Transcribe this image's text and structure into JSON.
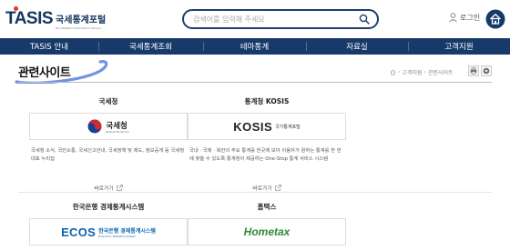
{
  "header": {
    "logo_main": "TASIS",
    "logo_kr": "국세통계포털",
    "logo_en": "Tax Statistics Information Service",
    "search_placeholder": "검색어를 입력해 주세요",
    "login_label": "로그인"
  },
  "nav": {
    "items": [
      "TASIS 안내",
      "국세통계조회",
      "테마통계",
      "자료실",
      "고객지원"
    ]
  },
  "page": {
    "title": "관련사이트",
    "breadcrumb": [
      "고객지원",
      "관련사이트"
    ]
  },
  "cards": [
    {
      "title": "국세청",
      "logo_text": "국세청",
      "logo_sub": "National Tax Service",
      "description": "국세청 소식, 국민소통, 국세신고안내, 국세정책 및 제도, 정보공개 등 국세청 대표 누리집",
      "link_label": "바로가기"
    },
    {
      "title": "통계청 KOSIS",
      "logo_text": "KOSIS",
      "logo_sub": "국가통계포털",
      "description": "국내 · 국제 · 북한의 주요 통계를 한곳에 모아 이용자가 원하는 통계를 한 번에 찾을 수 있도록 통계청이 제공하는 One-Stop 통계 서비스 시스템",
      "link_label": "바로가기"
    },
    {
      "title": "한국은행 경제통계시스템",
      "logo_text": "ECOS",
      "logo_sub": "한국은행 경제통계시스템",
      "logo_sub2": "Economic Statistics System"
    },
    {
      "title": "홈택스",
      "logo_text": "Hometax"
    }
  ],
  "colors": {
    "navy": "#173a6a",
    "logo_red": "#e7332a",
    "kosis_red": "#d6232a",
    "ecos_blue": "#0a62b0",
    "hometax_green": "#2e8a3a",
    "pen_blue": "#5b7fe0"
  }
}
